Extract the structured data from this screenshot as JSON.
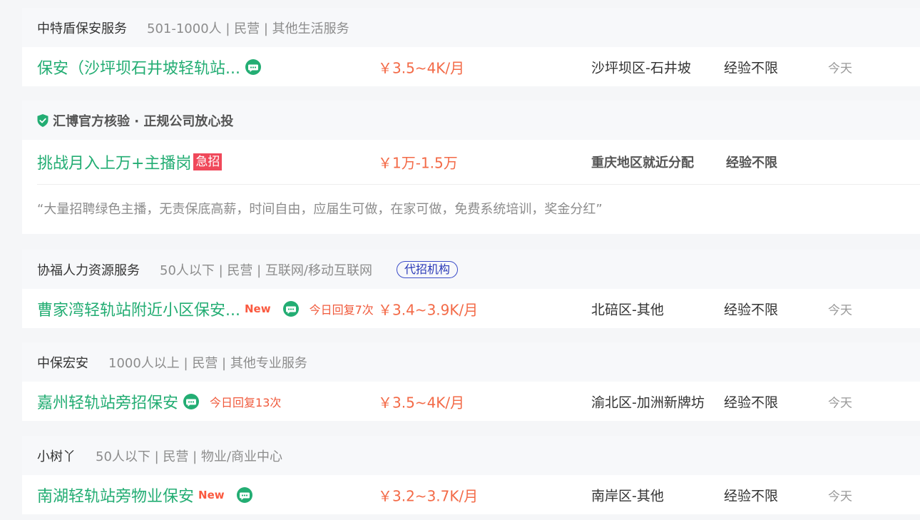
{
  "listings": [
    {
      "company": "中特盾保安服务",
      "meta": "501-1000人 | 民营 | 其他生活服务",
      "title": "保安（沙坪坝石井坡轻轨站...",
      "salary": "￥3.5~4K/月",
      "area": "沙坪坝区-石井坡",
      "experience": "经验不限",
      "date": "今天",
      "icon": "chat-bubble-icon"
    },
    {
      "verified_text": "汇博官方核验 · 正规公司放心投",
      "title": "挑战月入上万+主播岗",
      "urgent_label": "急招",
      "salary": "￥1万-1.5万",
      "area": "重庆地区就近分配",
      "experience": "经验不限",
      "description": "“大量招聘绿色主播，无责保底高薪，时间自由，应届生可做，在家可做，免费系统培训，奖金分红”",
      "icon": "shield-check-icon"
    },
    {
      "company": "协福人力资源服务",
      "meta": "50人以下 | 民营 | 互联网/移动互联网",
      "agent_tag": "代招机构",
      "title": "曹家湾轻轨站附近小区保安...",
      "new_label": "New",
      "reply": "今日回复7次",
      "salary": "￥3.4~3.9K/月",
      "area": "北碚区-其他",
      "experience": "经验不限",
      "date": "今天",
      "icon": "chat-bubble-icon"
    },
    {
      "company": "中保宏安",
      "meta": "1000人以上 | 民营 | 其他专业服务",
      "title": "嘉州轻轨站旁招保安",
      "reply": "今日回复13次",
      "salary": "￥3.5~4K/月",
      "area": "渝北区-加洲新牌坊",
      "experience": "经验不限",
      "date": "今天",
      "icon": "chat-bubble-icon"
    },
    {
      "company": "小树丫",
      "meta": "50人以下 | 民营 | 物业/商业中心",
      "title": "南湖轻轨站旁物业保安",
      "new_label": "New",
      "salary": "￥3.2~3.7K/月",
      "area": "南岸区-其他",
      "experience": "经验不限",
      "date": "今天",
      "icon": "chat-bubble-icon"
    }
  ],
  "colors": {
    "title_green": "#23ad73",
    "salary_orange": "#f36a47",
    "urgent_red": "#f0485a",
    "agent_blue": "#3d4ec9"
  }
}
